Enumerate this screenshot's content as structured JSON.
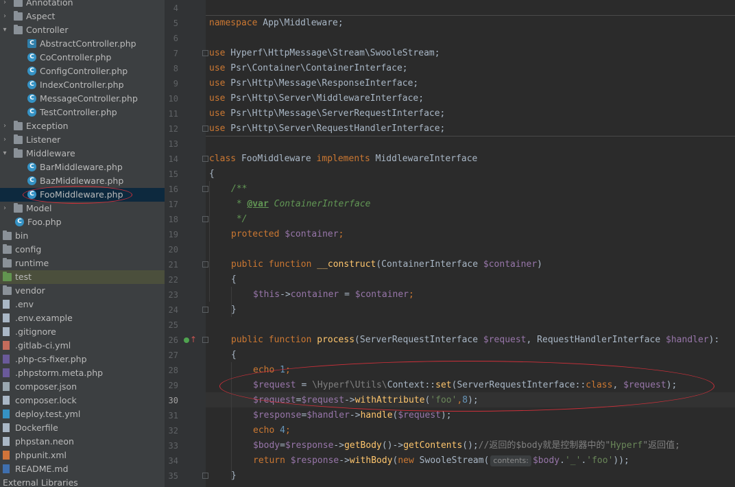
{
  "project_tree": {
    "items": [
      {
        "label": "Annotation",
        "type": "folder",
        "expanded": false
      },
      {
        "label": "Aspect",
        "type": "folder",
        "expanded": false
      },
      {
        "label": "Controller",
        "type": "folder",
        "expanded": true
      },
      {
        "label": "AbstractController.php",
        "type": "abstract-class"
      },
      {
        "label": "CoController.php",
        "type": "class"
      },
      {
        "label": "ConfigController.php",
        "type": "class"
      },
      {
        "label": "IndexController.php",
        "type": "class"
      },
      {
        "label": "MessageController.php",
        "type": "class"
      },
      {
        "label": "TestController.php",
        "type": "class"
      },
      {
        "label": "Exception",
        "type": "folder",
        "expanded": false
      },
      {
        "label": "Listener",
        "type": "folder",
        "expanded": false
      },
      {
        "label": "Middleware",
        "type": "folder",
        "expanded": true
      },
      {
        "label": "BarMiddleware.php",
        "type": "class"
      },
      {
        "label": "BazMiddleware.php",
        "type": "class"
      },
      {
        "label": "FooMiddleware.php",
        "type": "class",
        "selected": true
      },
      {
        "label": "Model",
        "type": "folder",
        "expanded": false
      },
      {
        "label": "Foo.php",
        "type": "class"
      },
      {
        "label": "bin",
        "type": "folder"
      },
      {
        "label": "config",
        "type": "folder"
      },
      {
        "label": "runtime",
        "type": "folder"
      },
      {
        "label": "test",
        "type": "folder-test"
      },
      {
        "label": "vendor",
        "type": "folder"
      },
      {
        "label": ".env",
        "type": "file"
      },
      {
        "label": ".env.example",
        "type": "file"
      },
      {
        "label": ".gitignore",
        "type": "file"
      },
      {
        "label": ".gitlab-ci.yml",
        "type": "file-yml"
      },
      {
        "label": ".php-cs-fixer.php",
        "type": "file-php"
      },
      {
        "label": ".phpstorm.meta.php",
        "type": "file-php"
      },
      {
        "label": "composer.json",
        "type": "file-json"
      },
      {
        "label": "composer.lock",
        "type": "file"
      },
      {
        "label": "deploy.test.yml",
        "type": "file-docker"
      },
      {
        "label": "Dockerfile",
        "type": "file"
      },
      {
        "label": "phpstan.neon",
        "type": "file"
      },
      {
        "label": "phpunit.xml",
        "type": "file-xml"
      },
      {
        "label": "README.md",
        "type": "file-md"
      },
      {
        "label": "External Libraries",
        "type": "libraries"
      }
    ]
  },
  "editor": {
    "file": "FooMiddleware.php",
    "current_line": 30,
    "line_numbers": [
      "4",
      "5",
      "6",
      "7",
      "8",
      "9",
      "10",
      "11",
      "12",
      "13",
      "14",
      "15",
      "16",
      "17",
      "18",
      "19",
      "20",
      "21",
      "22",
      "23",
      "24",
      "25",
      "26",
      "27",
      "28",
      "29",
      "30",
      "31",
      "32",
      "33",
      "34",
      "35"
    ],
    "code": {
      "l5": [
        "namespace",
        " App\\Middleware;"
      ],
      "l7": [
        "use",
        " Hyperf\\HttpMessage\\Stream\\SwooleStream;"
      ],
      "l8": [
        "use",
        " Psr\\Container\\ContainerInterface;"
      ],
      "l9": [
        "use",
        " Psr\\Http\\Message\\ResponseInterface;"
      ],
      "l10": [
        "use",
        " Psr\\Http\\Server\\MiddlewareInterface;"
      ],
      "l11": [
        "use",
        " Psr\\Http\\Message\\ServerRequestInterface;"
      ],
      "l12": [
        "use",
        " Psr\\Http\\Server\\RequestHandlerInterface;"
      ],
      "l14": [
        "class",
        " FooMiddleware ",
        "implements",
        " MiddlewareInterface"
      ],
      "l15": [
        "{"
      ],
      "l16": [
        "/**"
      ],
      "l17": [
        " * ",
        "@var",
        " ContainerInterface"
      ],
      "l18": [
        " */"
      ],
      "l19": [
        "protected",
        " ",
        "$container",
        ";"
      ],
      "l21": [
        "public",
        " ",
        "function",
        " ",
        "__construct",
        "(ContainerInterface ",
        "$container",
        ")"
      ],
      "l22": [
        "{"
      ],
      "l23": [
        "$this",
        "->",
        "container",
        " = ",
        "$container",
        ";"
      ],
      "l24": [
        "}"
      ],
      "l26": [
        "public",
        " ",
        "function",
        " ",
        "process",
        "(ServerRequestInterface ",
        "$request",
        ", RequestHandlerInterface ",
        "$handler",
        "):"
      ],
      "l27": [
        "{"
      ],
      "l28": [
        "echo",
        " ",
        "1",
        ";"
      ],
      "l29": [
        "$request",
        " = ",
        "\\Hyperf\\Utils\\",
        "Context::",
        "set",
        "(ServerRequestInterface::",
        "class",
        ", ",
        "$request",
        ");"
      ],
      "l30": [
        "$request",
        "=",
        "$request",
        "->",
        "withAttribute",
        "(",
        "'foo'",
        ",",
        "8",
        ");"
      ],
      "l31": [
        "$response",
        "=",
        "$handler",
        "->",
        "handle",
        "(",
        "$request",
        ");"
      ],
      "l32": [
        "echo",
        " ",
        "4",
        ";"
      ],
      "l33": [
        "$body",
        "=",
        "$response",
        "->",
        "getBody",
        "()->",
        "getContents",
        "();",
        "//返回的$body就是控制器中的\"",
        "Hyperf",
        "\"返回值;"
      ],
      "l34": [
        "return",
        " ",
        "$response",
        "->",
        "withBody",
        "(",
        "new",
        " SwooleStream(",
        "contents:",
        "$body",
        ".",
        "'_'",
        ".",
        "'foo'",
        "));"
      ],
      "l35": [
        "}"
      ]
    }
  },
  "colors": {
    "keyword": "#cc7832",
    "variable": "#9876aa",
    "function": "#ffc66d",
    "string": "#6a8759",
    "number": "#6897bb",
    "annotation_circle": "#d0303a"
  }
}
